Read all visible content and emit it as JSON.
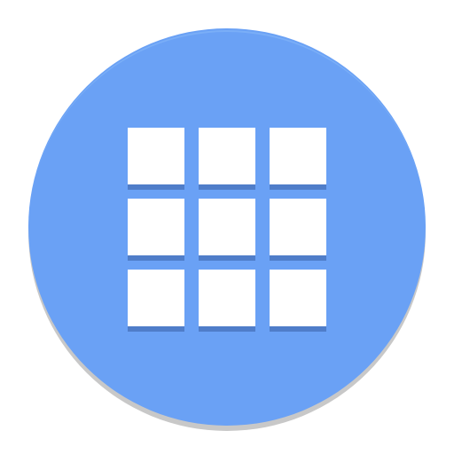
{
  "app_icon": {
    "name": "app-grid-icon",
    "colors": {
      "background": "#ffffff",
      "circle": "#6aa1f5",
      "circle_highlight": "#7aaef7",
      "circle_shadow": "#c8c8c8",
      "tile": "#ffffff",
      "tile_shadow": "#4f7dc9"
    },
    "grid": {
      "rows": 3,
      "columns": 3
    }
  }
}
